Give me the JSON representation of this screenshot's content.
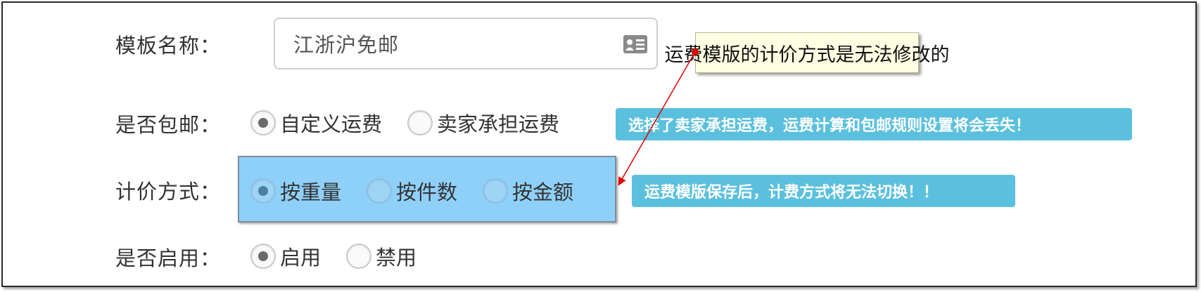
{
  "form": {
    "template_name_label": "模板名称：",
    "template_name_value": "江浙沪免邮",
    "free_shipping_label": "是否包邮：",
    "free_shipping_options": [
      "自定义运费",
      "卖家承担运费"
    ],
    "pricing_method_label": "计价方式：",
    "pricing_method_options": [
      "按重量",
      "按件数",
      "按金额"
    ],
    "enabled_label": "是否启用：",
    "enabled_options": [
      "启用",
      "禁用"
    ]
  },
  "annotations": {
    "note": "运费模版的计价方式是无法修改的",
    "tip_free_shipping": "选择了卖家承担运费，运费计算和包邮规则设置将会丢失！",
    "tip_pricing": "运费模版保存后，计费方式将无法切换！！"
  },
  "icons": {
    "input_card": "id-card-icon"
  },
  "colors": {
    "tip_bg": "#5bc0de",
    "highlight_bg": "#8fd0f8",
    "note_bg": "#fefee2",
    "arrow": "#e00000"
  }
}
